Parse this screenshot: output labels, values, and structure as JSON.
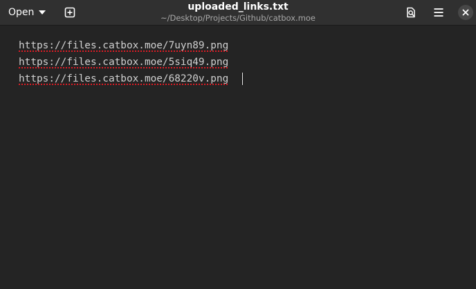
{
  "header": {
    "open_label": "Open",
    "title": "uploaded_links.txt",
    "subtitle": "~/Desktop/Projects/Github/catbox.moe",
    "icons": {
      "new_tab": "new-tab-icon",
      "search": "search-icon",
      "menu": "hamburger-menu-icon",
      "close": "close-icon"
    }
  },
  "editor": {
    "lines": [
      "https://files.catbox.moe/7uyn89.png",
      "https://files.catbox.moe/5siq49.png",
      "https://files.catbox.moe/68220v.png"
    ]
  },
  "colors": {
    "headerbar": "#303030",
    "editor_background": "#242424",
    "text": "#d0d0d0",
    "spellcheck_underline": "#e01b24"
  }
}
